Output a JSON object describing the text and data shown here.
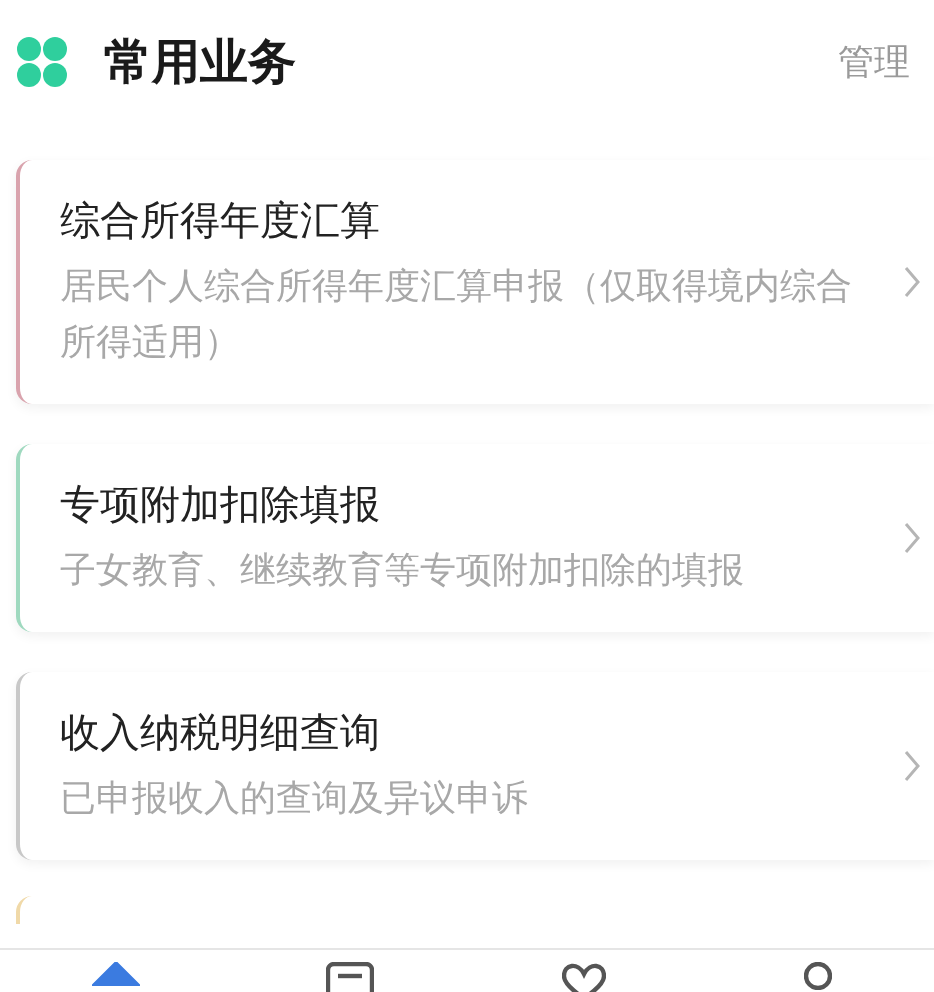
{
  "header": {
    "title": "常用业务",
    "action": "管理"
  },
  "services": [
    {
      "title": "综合所得年度汇算",
      "description": "居民个人综合所得年度汇算申报（仅取得境内综合所得适用）",
      "color": "#d9a3ad"
    },
    {
      "title": "专项附加扣除填报",
      "description": "子女教育、继续教育等专项附加扣除的填报",
      "color": "#9fd9bf"
    },
    {
      "title": "收入纳税明细查询",
      "description": "已申报收入的查询及异议申诉",
      "color": "#c8c8c8"
    }
  ],
  "tab_bar": [
    {
      "kind": "home",
      "selected": true
    },
    {
      "kind": "message",
      "selected": false
    },
    {
      "kind": "heart",
      "selected": false
    },
    {
      "kind": "person",
      "selected": false
    }
  ]
}
